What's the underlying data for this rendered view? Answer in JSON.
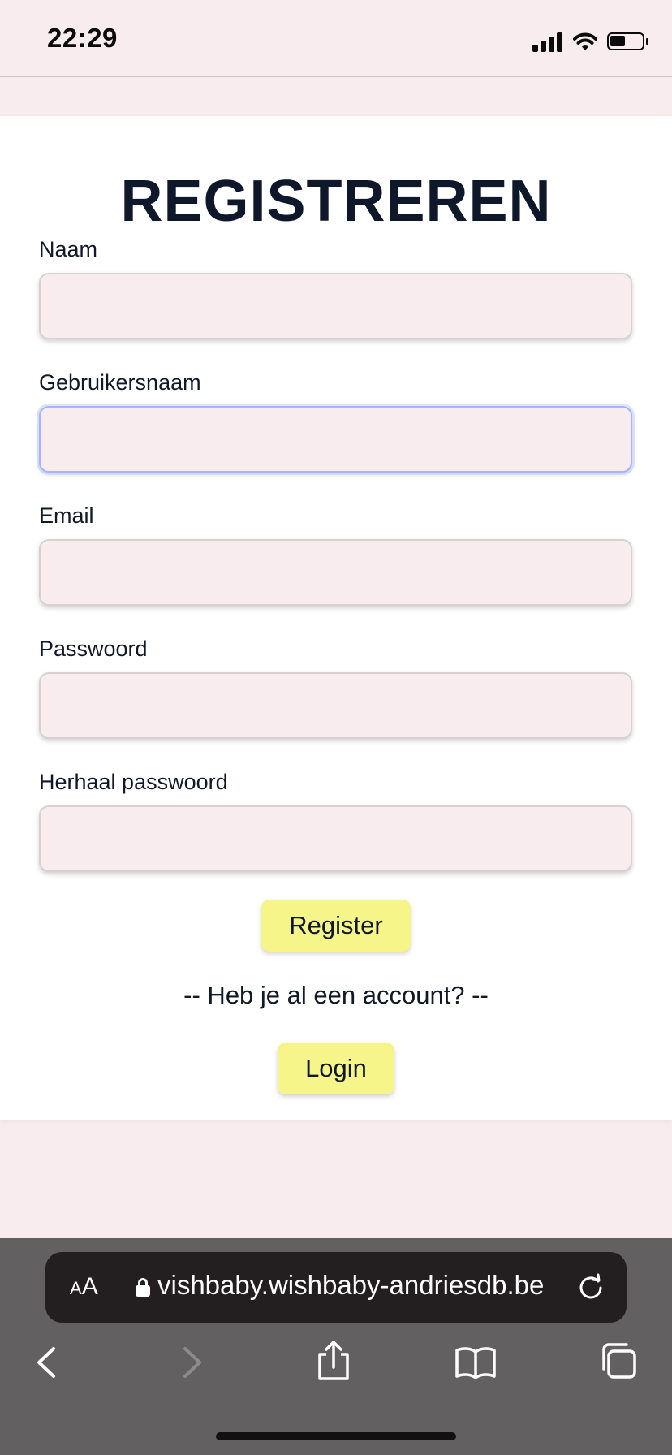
{
  "status_bar": {
    "time": "22:29",
    "icons": [
      "signal-icon",
      "wifi-icon",
      "battery-icon"
    ]
  },
  "form": {
    "title": "REGISTREREN",
    "fields": [
      {
        "label": "Naam",
        "value": ""
      },
      {
        "label": "Gebruikersnaam",
        "value": ""
      },
      {
        "label": "Email",
        "value": ""
      },
      {
        "label": "Passwoord",
        "value": ""
      },
      {
        "label": "Herhaal passwoord",
        "value": ""
      }
    ],
    "register_label": "Register",
    "account_prompt": "-- Heb je al een account? --",
    "login_label": "Login"
  },
  "browser": {
    "aa_small": "A",
    "aa_large": "A",
    "url": "vishbaby.wishbaby-andriesdb.be",
    "icons": [
      "lock-icon",
      "reload-icon",
      "back-icon",
      "forward-icon",
      "share-icon",
      "bookmarks-icon",
      "tabs-icon"
    ]
  },
  "colors": {
    "page_background": "#f8ecef",
    "card_background": "#ffffff",
    "input_background": "#f8ecef",
    "button_yellow": "#f6f58a",
    "focus_ring": "#a5b4fc",
    "browser_bar": "#636062",
    "url_bar": "#231f20"
  }
}
